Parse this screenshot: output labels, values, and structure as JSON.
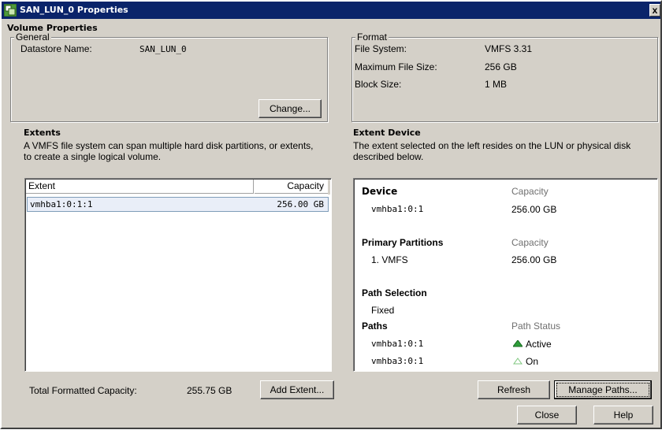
{
  "window": {
    "title": "SAN_LUN_0 Properties",
    "close_glyph": "x"
  },
  "volume": {
    "heading": "Volume Properties",
    "general": {
      "legend": "General",
      "datastore_label": "Datastore Name:",
      "datastore_value": "SAN_LUN_0",
      "change_button": "Change..."
    },
    "format": {
      "legend": "Format",
      "fs_label": "File System:",
      "fs_value": "VMFS 3.31",
      "maxsize_label": "Maximum File Size:",
      "maxsize_value": "256 GB",
      "block_label": "Block Size:",
      "block_value": "1 MB"
    }
  },
  "extents": {
    "heading": "Extents",
    "desc_line1": "A VMFS file system can span multiple hard disk partitions, or extents,",
    "desc_line2": "to create a single logical volume.",
    "columns": [
      "Extent",
      "Capacity"
    ],
    "rows": [
      {
        "extent": "vmhba1:0:1:1",
        "capacity": "256.00 GB"
      }
    ],
    "total_label": "Total Formatted Capacity:",
    "total_value": "255.75 GB",
    "add_button": "Add Extent..."
  },
  "extent_device": {
    "heading": "Extent Device",
    "desc_line1": "The extent selected on the left resides on the LUN or physical disk",
    "desc_line2": "described below.",
    "device_label": "Device",
    "device_cap_label": "Capacity",
    "device_name": "vmhba1:0:1",
    "device_cap": "256.00 GB",
    "partitions_label": "Primary Partitions",
    "partitions_cap_label": "Capacity",
    "partition_name": "1. VMFS",
    "partition_cap": "256.00 GB",
    "path_selection_label": "Path Selection",
    "path_selection_value": "Fixed",
    "paths_label": "Paths",
    "path_status_label": "Path Status",
    "paths": [
      {
        "name": "vmhba1:0:1",
        "status": "Active",
        "icon": "active-status-icon"
      },
      {
        "name": "vmhba3:0:1",
        "status": "On",
        "icon": "standby-status-icon"
      }
    ],
    "refresh_button": "Refresh",
    "manage_button": "Manage Paths..."
  },
  "footer": {
    "close_button": "Close",
    "help_button": "Help"
  },
  "colors": {
    "title_bg": "#0a246a",
    "dialog_bg": "#d4d0c8",
    "selection": "#e9eef8",
    "active_green": "#2e9e3a"
  }
}
